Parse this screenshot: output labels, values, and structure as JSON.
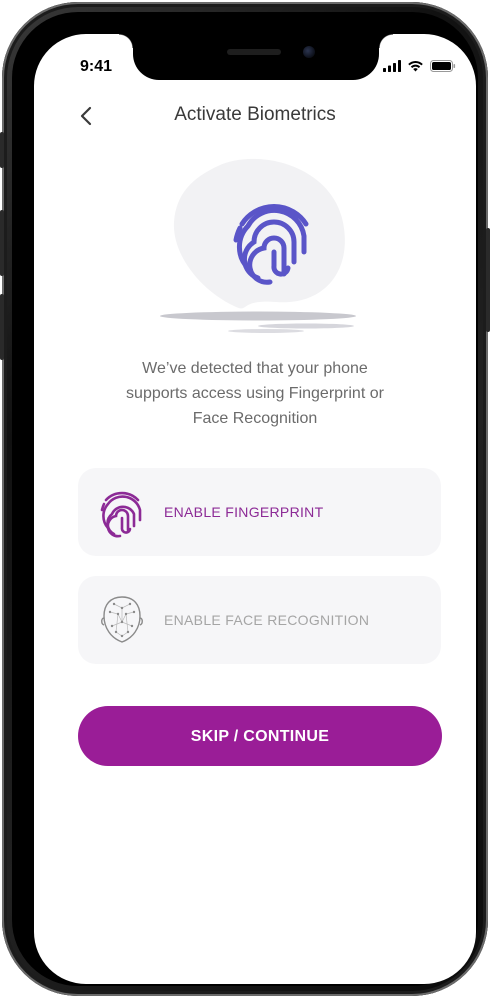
{
  "status_bar": {
    "time": "9:41",
    "signal_icon": "cellular-signal-icon",
    "wifi_icon": "wifi-icon",
    "battery_icon": "battery-icon"
  },
  "header": {
    "back_icon": "chevron-left-icon",
    "title": "Activate Biometrics"
  },
  "hero": {
    "icon": "fingerprint-icon",
    "accent": "#5a55c8"
  },
  "description": {
    "line1": "We’ve detected that your phone",
    "line2": "supports access using Fingerprint or",
    "line3": "Face Recognition"
  },
  "options": [
    {
      "label": "ENABLE FINGERPRINT",
      "icon": "fingerprint-icon",
      "color": "#8c2a96"
    },
    {
      "label": "ENABLE FACE RECOGNITION",
      "icon": "face-scan-icon",
      "color": "#a5a5a5"
    }
  ],
  "primary_button": {
    "label": "SKIP / CONTINUE",
    "color": "#9a1d97"
  }
}
